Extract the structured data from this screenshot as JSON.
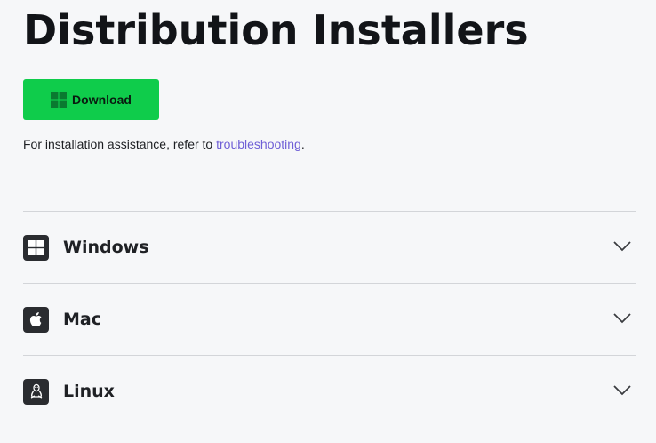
{
  "page": {
    "title": "Distribution Installers"
  },
  "download": {
    "label": "Download",
    "icon": "windows-icon",
    "color": "#0fcc4b"
  },
  "assistance": {
    "prefix": "For installation assistance, refer to ",
    "link_text": "troubleshooting",
    "suffix": ".",
    "link_color": "#6f5fd6"
  },
  "platforms": [
    {
      "name": "Windows",
      "icon": "windows-icon"
    },
    {
      "name": "Mac",
      "icon": "apple-icon"
    },
    {
      "name": "Linux",
      "icon": "linux-icon"
    }
  ]
}
